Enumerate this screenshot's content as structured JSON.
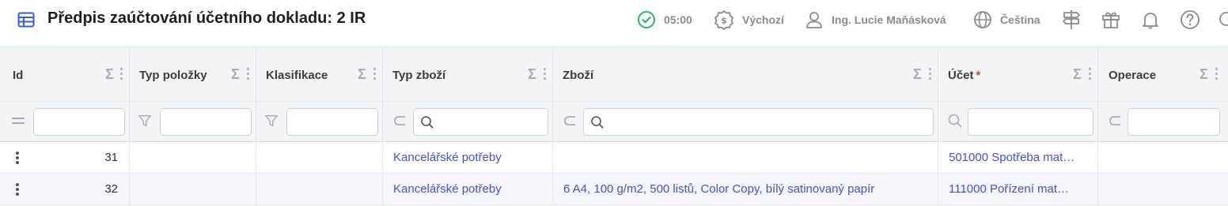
{
  "header": {
    "title": "Předpis zaúčtování účetního dokladu: 2 IR",
    "icons": [
      "table-icon",
      "check-circle-icon",
      "currency-badge-icon",
      "user-icon",
      "globe-icon",
      "signpost-icon",
      "gift-icon",
      "bell-icon",
      "help-icon",
      "search-icon"
    ],
    "timer": "05:00",
    "currency": "Výchozí",
    "user": "Ing. Lucie Maňásková",
    "language": "Čeština",
    "colors": {
      "accent": "#3b5bdb",
      "success": "#2fb170"
    }
  },
  "grid": {
    "columns": [
      {
        "label": "Id",
        "required": false
      },
      {
        "label": "Typ položky",
        "required": false
      },
      {
        "label": "Klasifikace",
        "required": false
      },
      {
        "label": "Typ zboží",
        "required": false
      },
      {
        "label": "Zboží",
        "required": false
      },
      {
        "label": "Účet",
        "required": true,
        "required_mark": "*"
      },
      {
        "label": "Operace",
        "required": false
      }
    ],
    "filter_operators": [
      "=",
      "funnel",
      "⊂ search",
      "⊂ search",
      "search",
      "⊂"
    ],
    "rows": [
      {
        "id": "31",
        "typ_polozky": "",
        "klasifikace": "",
        "typ_zbozi": "Kancelářské potřeby",
        "zbozi": "",
        "ucet": "501000 Spotřeba mat…",
        "operace": ""
      },
      {
        "id": "32",
        "typ_polozky": "",
        "klasifikace": "",
        "typ_zbozi": "Kancelářské potřeby",
        "zbozi": "6 A4, 100 g/m2, 500 listů, Color Copy, bílý satinovaný papír",
        "ucet": "111000 Pořízení mat…",
        "operace": ""
      }
    ],
    "colors": {
      "link": "#4a4fc2",
      "header_bg": "#f3f4f6",
      "row_alt": "#f4f6fb",
      "required": "#e0403a"
    }
  }
}
